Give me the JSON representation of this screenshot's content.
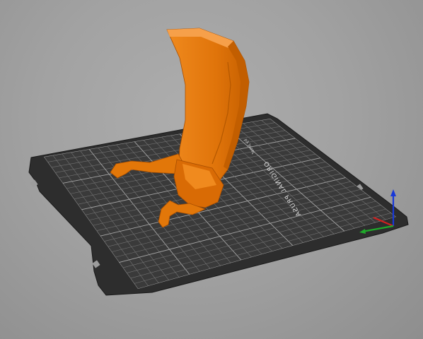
{
  "bed": {
    "logo_text": "ORIGINAL PRUSA",
    "logo_subtext": "by Josef"
  },
  "model": {
    "color": "#e0740a"
  },
  "axes": {
    "x_color": "#d12020",
    "y_color": "#1faa2a",
    "z_color": "#1838d8"
  },
  "colors": {
    "background": "#a4a4a4",
    "bed": "#2f2f2f",
    "grid": "#8a8a8a"
  }
}
